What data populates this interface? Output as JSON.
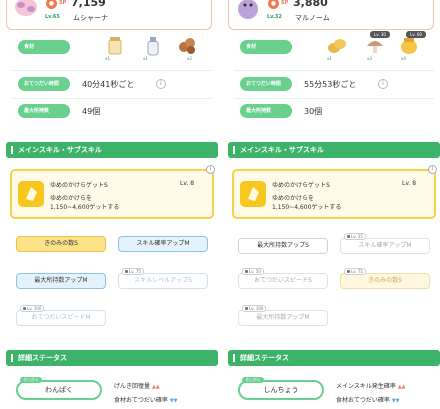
{
  "left": {
    "pokemon_name": "ムシャーナ",
    "level": "Lv.65",
    "sp_label": "SP",
    "sp_value": "7,159",
    "tags": {
      "ingredients": "食材",
      "help_time": "おてつだい時間",
      "max_carry": "最大所持数"
    },
    "ingredients": [
      {
        "icon": "jar-icon",
        "count": "x1"
      },
      {
        "icon": "milk-bottle-icon",
        "count": "x1"
      },
      {
        "icon": "cacao-icon",
        "count": "x2"
      }
    ],
    "help_time": "40分41秒ごと",
    "max_carry": "49個",
    "section_skills": "メインスキル・サブスキル",
    "main_skill": {
      "name": "ゆめのかけらゲットS",
      "level": "Lv. 8",
      "desc_line1": "ゆめのかけらを",
      "desc_line2": "1,150~4,600ゲットする"
    },
    "sub_skills": [
      {
        "label": "きのみの数S",
        "lock": ""
      },
      {
        "label": "スキル確率アップM",
        "lock": ""
      },
      {
        "label": "最大所持数アップM",
        "lock": ""
      },
      {
        "label": "スキルレベルアップS",
        "lock": "Lv. 75"
      },
      {
        "label": "おてつだいスピードM",
        "lock": "Lv. 100"
      }
    ],
    "section_status": "詳細ステータス",
    "nature_tag": "せいかく",
    "nature": "わんぱく",
    "effects": [
      {
        "label": "げんき回復量",
        "arrows": "▲▲"
      },
      {
        "label": "食材おてつだい確率",
        "arrows": "▼▼"
      }
    ]
  },
  "right": {
    "pokemon_name": "マルノーム",
    "level": "Lv.32",
    "sp_label": "SP",
    "sp_value": "3,880",
    "tags": {
      "ingredients": "食材",
      "help_time": "おてつだい時間",
      "max_carry": "最大所持数"
    },
    "ingredients": [
      {
        "icon": "potato-icon",
        "count": "x1"
      },
      {
        "icon": "mushroom-icon",
        "count": "x3",
        "lock": "Lv. 30"
      },
      {
        "icon": "honey-pot-icon",
        "count": "x4",
        "lock": "Lv. 60"
      }
    ],
    "help_time": "55分53秒ごと",
    "max_carry": "30個",
    "section_skills": "メインスキル・サブスキル",
    "main_skill": {
      "name": "ゆめのかけらゲットS",
      "level": "Lv. 8",
      "desc_line1": "ゆめのかけらを",
      "desc_line2": "1,150~4,600ゲットする"
    },
    "sub_skills": [
      {
        "label": "最大所持数アップS",
        "lock": ""
      },
      {
        "label": "スキル確率アップM",
        "lock": "Lv. 25"
      },
      {
        "label": "おてつだいスピードS",
        "lock": "Lv. 50"
      },
      {
        "label": "きのみの数S",
        "lock": "Lv. 75"
      },
      {
        "label": "最大所持数アップM",
        "lock": "Lv. 100"
      }
    ],
    "section_status": "詳細ステータス",
    "nature_tag": "せいかく",
    "nature": "しんちょう",
    "effects": [
      {
        "label": "メインスキル発生確率",
        "arrows": "▲▲"
      },
      {
        "label": "食材おてつだい確率",
        "arrows": "▼▼"
      }
    ]
  },
  "colors": {
    "accent_green": "#3db36a",
    "tag_green": "#6ad08e",
    "sp_orange": "#f07850",
    "skill_gold": "#f7d24a"
  }
}
